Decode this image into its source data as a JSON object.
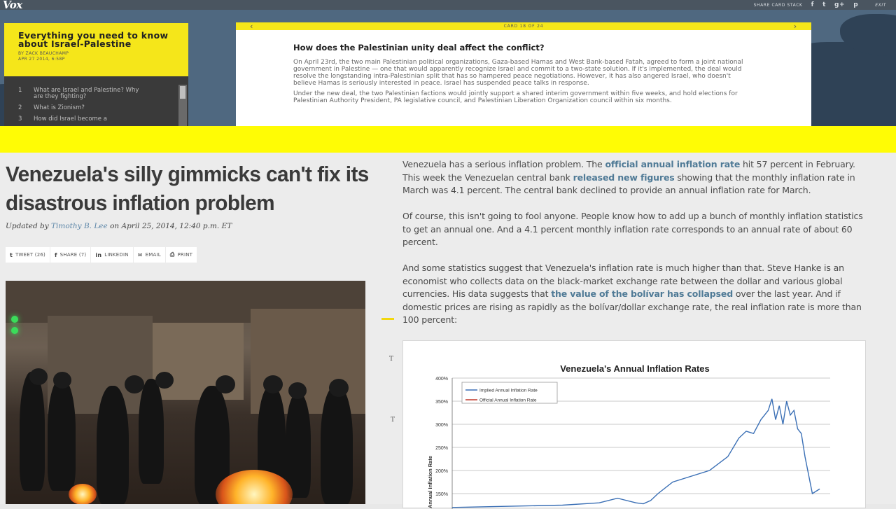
{
  "top": {
    "logo": "Vox",
    "nav": {
      "share_label": "SHARE CARD STACK",
      "fb": "f",
      "tw": "t",
      "gp": "g+",
      "pin": "p",
      "exit": "EXIT"
    },
    "stack": {
      "title": "Everything you need to know about Israel-Palestine",
      "author": "BY ZACK BEAUCHAMP",
      "date": "APR 27 2014, 6:58P",
      "toc": [
        {
          "n": "1",
          "label": "What are Israel and Palestine? Why are they fighting?"
        },
        {
          "n": "2",
          "label": "What is Zionism?"
        },
        {
          "n": "3",
          "label": "How did Israel become a"
        }
      ]
    },
    "card": {
      "counter": "CARD 18 OF 24",
      "prev": "‹",
      "next": "›",
      "heading": "How does the Palestinian unity deal affect the conflict?",
      "p1": "On April 23rd, the two main Palestinian political organizations, Gaza-based Hamas and West Bank-based Fatah, agreed to form a joint national government in Palestine — one that would apparently recognize Israel and commit to a two-state solution. If it's implemented, the deal would resolve the longstanding intra-Palestinian split that has so hampered peace negotiations. However, it has also angered Israel, who doesn't believe Hamas is seriously interested in peace. Israel has suspended peace talks in response.",
      "p2": "Under the new deal, the two Palestinian factions would jointly support a shared interim government within five weeks, and hold elections for Palestinian Authority President, PA legislative council, and Palestinian Liberation Organization council within six months."
    }
  },
  "article": {
    "headline": "Venezuela's silly gimmicks can't fix its disastrous inflation problem",
    "byline_prefix": "Updated by ",
    "byline_author": "Timothy B. Lee",
    "byline_suffix": " on April 25, 2014, 12:40 p.m. ET",
    "share": [
      {
        "icon": "t",
        "label": "TWEET (26)"
      },
      {
        "icon": "f",
        "label": "SHARE (7)"
      },
      {
        "icon": "in",
        "label": "LINKEDIN"
      },
      {
        "icon": "✉",
        "label": "EMAIL"
      },
      {
        "icon": "⎙",
        "label": "PRINT"
      }
    ],
    "p1": {
      "a": "Venezuela has a serious inflation problem. The ",
      "l1": "official annual inflation rate",
      "b": " hit 57 percent in February. This week the Venezuelan central bank ",
      "l2": "released new figures",
      "c": " showing that the monthly inflation rate in March was 4.1 percent. The central bank declined to provide an annual inflation rate for March."
    },
    "p2": "Of course, this isn't going to fool anyone. People know how to add up a bunch of monthly inflation statistics to get an annual one. And a 4.1 percent monthly inflation rate corresponds to an annual rate of about 60 percent.",
    "p3": {
      "a": "And some statistics suggest that Venezuela's inflation rate is much higher than that. Steve Hanke is an economist who collects data on the black-market exchange rate between the dollar and various global currencies. His data suggests that ",
      "l1": "the value of the bolívar has collapsed",
      "b": " over the last year. And if domestic prices are rising as rapidly as the bolívar/dollar exchange rate, the real inflation rate is more than 100 percent:"
    },
    "tmark": "T"
  },
  "chart_data": {
    "type": "line",
    "title": "Venezuela's Annual Inflation Rates",
    "ylabel": "Annual Inflation Rate",
    "xlabel": "",
    "ylim": [
      0,
      400
    ],
    "ytick_labels": [
      "150%",
      "200%",
      "250%",
      "300%",
      "350%",
      "400%"
    ],
    "legend_position": "top-left",
    "series": [
      {
        "name": "Implied Annual Inflation Rate",
        "color": "#3a6fb5",
        "x": [
          0,
          30,
          40,
          45,
          50,
          52,
          54,
          56,
          60,
          70,
          75,
          78,
          80,
          82,
          84,
          86,
          87,
          88,
          89,
          90,
          91,
          92,
          93,
          94,
          95,
          96,
          97,
          98,
          100
        ],
        "values": [
          120,
          125,
          130,
          140,
          130,
          128,
          135,
          150,
          175,
          200,
          230,
          270,
          285,
          280,
          310,
          330,
          355,
          310,
          340,
          300,
          350,
          320,
          330,
          290,
          280,
          230,
          190,
          150,
          160
        ]
      },
      {
        "name": "Official Annual Inflation Rate",
        "color": "#c0392b",
        "x": [],
        "values": []
      }
    ]
  }
}
